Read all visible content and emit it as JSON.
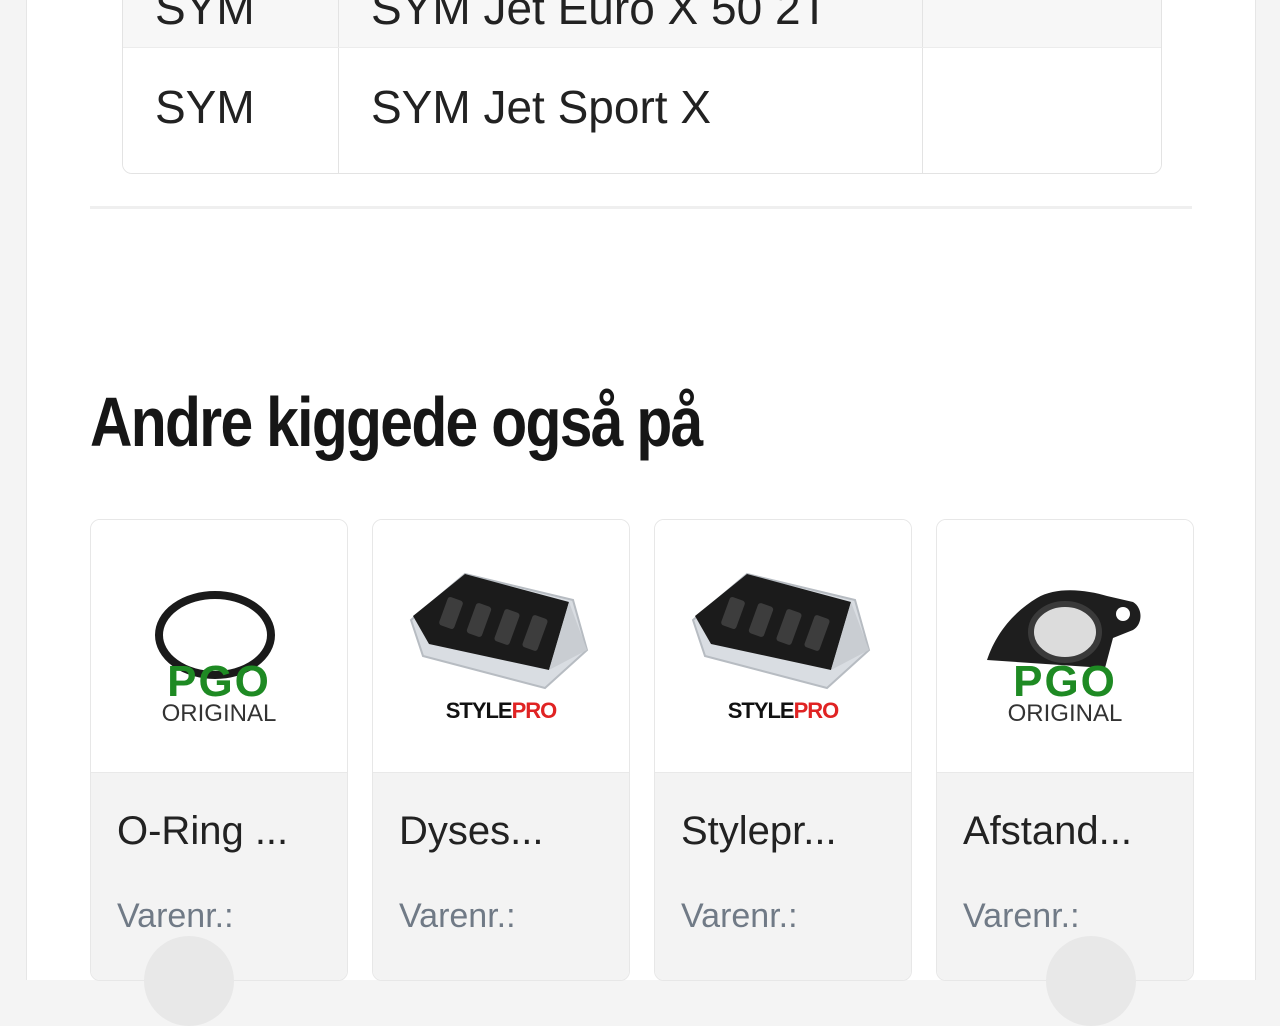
{
  "compat_table": {
    "rows": [
      {
        "brand": "SYM",
        "model": "SYM Jet Euro X 50 2T",
        "extra": ""
      },
      {
        "brand": "SYM",
        "model": "SYM Jet Sport X",
        "extra": ""
      }
    ]
  },
  "section_title": "Andre kiggede også på",
  "products": [
    {
      "name": "O-Ring ...",
      "sku_label": "Varenr.:",
      "image": "o-ring",
      "brand_logo": {
        "word": "PGO",
        "sub": "ORIGINAL"
      }
    },
    {
      "name": "Dyses...",
      "sku_label": "Varenr.:",
      "image": "reed-valve",
      "brand_logo": {
        "prefix": "STYLE",
        "suffix": "PRO"
      }
    },
    {
      "name": "Stylepr...",
      "sku_label": "Varenr.:",
      "image": "reed-valve",
      "brand_logo": {
        "prefix": "STYLE",
        "suffix": "PRO"
      }
    },
    {
      "name": "Afstand...",
      "sku_label": "Varenr.:",
      "image": "spacer-flange",
      "brand_logo": {
        "word": "PGO",
        "sub": "ORIGINAL"
      }
    }
  ],
  "colors": {
    "pgo_green": "#1e8a23",
    "stylepro_red": "#e02323",
    "sku_grey": "#707a86"
  }
}
